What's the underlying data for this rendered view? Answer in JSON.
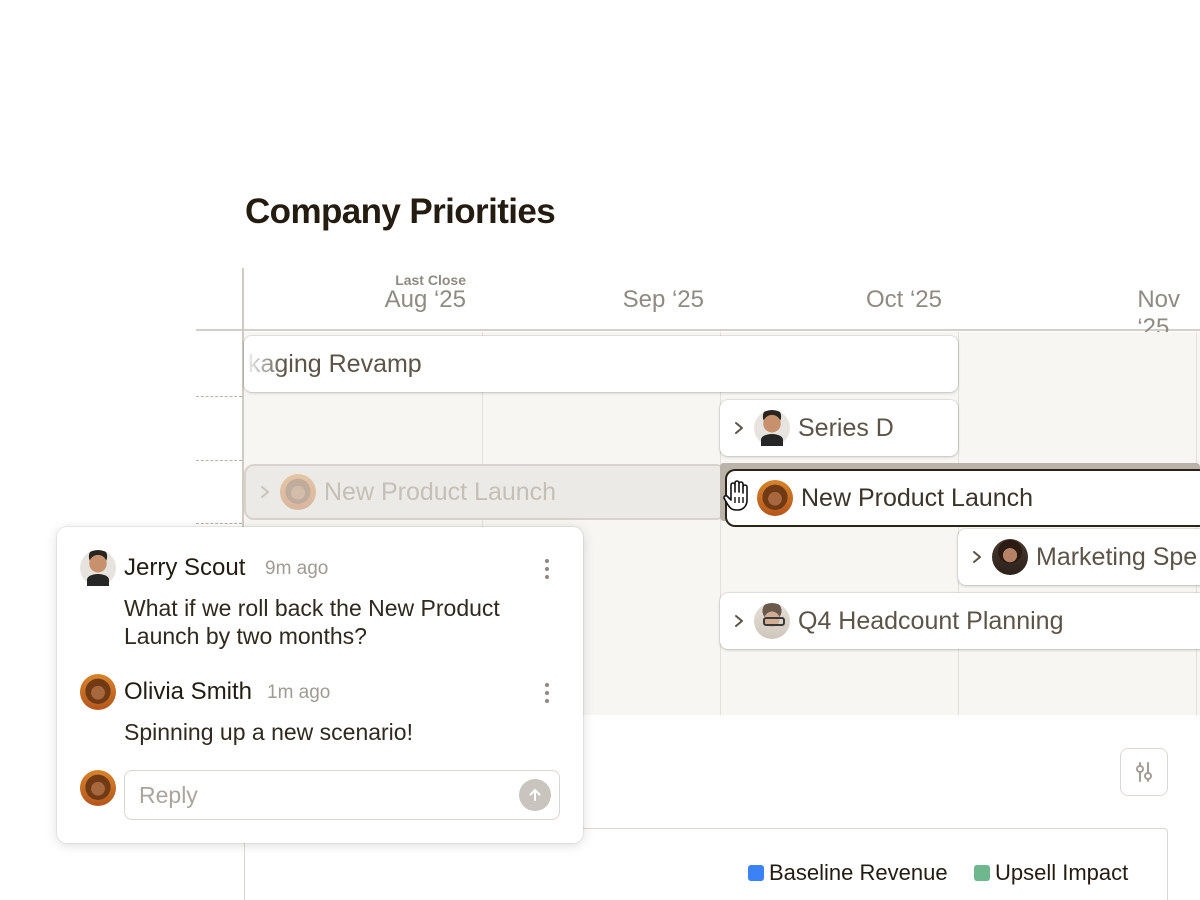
{
  "page": {
    "title": "Company Priorities"
  },
  "timeline": {
    "last_close_label": "Last Close",
    "months": [
      "Aug ‘25",
      "Sep ‘25",
      "Oct ‘25",
      "Nov ‘25"
    ]
  },
  "bars": {
    "packaging": {
      "label": "kaging Revamp"
    },
    "series_d": {
      "label": "Series D",
      "avatar": "jerry-avatar"
    },
    "ghost_launch": {
      "label": "New Product Launch",
      "avatar": "olivia-avatar"
    },
    "active_launch": {
      "label": "New Product Launch",
      "avatar": "olivia-avatar"
    },
    "marketing": {
      "label": "Marketing Spe",
      "avatar": "marketing-avatar"
    },
    "q4": {
      "label": "Q4 Headcount Planning",
      "avatar": "q4-avatar"
    }
  },
  "comments": [
    {
      "author": "Jerry Scout",
      "time": "9m ago",
      "body": "What if we roll back the New Product Launch by two months?"
    },
    {
      "author": "Olivia Smith",
      "time": "1m ago",
      "body": "Spinning up a new scenario!"
    }
  ],
  "reply": {
    "placeholder": "Reply"
  },
  "legend": [
    {
      "label": "Baseline Revenue",
      "color": "#3b82f6"
    },
    {
      "label": "Upsell Impact",
      "color": "#6fb88f"
    }
  ],
  "icons": {
    "chevron": "chevron-right-icon",
    "more": "more-vertical-icon",
    "send": "arrow-up-icon",
    "settings": "sliders-icon",
    "cursor": "grab-hand-cursor-icon"
  }
}
